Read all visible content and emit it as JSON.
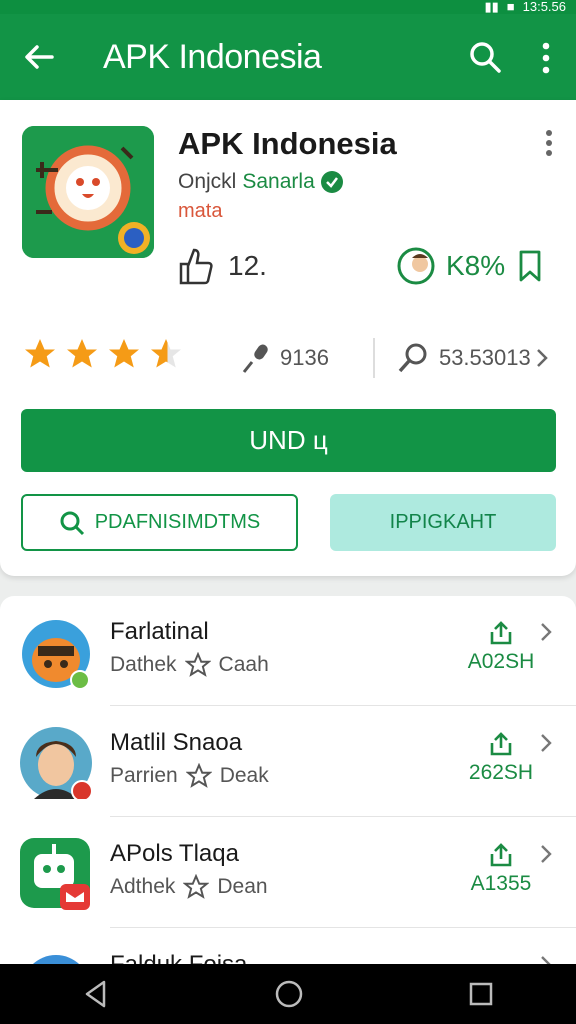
{
  "status_bar": {
    "time": "13:5.56"
  },
  "app_bar": {
    "title": "APK Indonesia"
  },
  "app": {
    "name": "APK Indonesia",
    "developer_prefix": "Onjckl",
    "developer_name": "Sanarla",
    "tag": "mata",
    "left_metric": "12.",
    "right_metric": "K8%",
    "rating_stars": 3.6,
    "downloads": "9136",
    "reviews": "53.53013"
  },
  "buttons": {
    "install": "UND ц",
    "secondary": "PDAFNISIMDTMS",
    "tertiary": "IPPIGKAHT"
  },
  "list": [
    {
      "name": "Farlatinal",
      "meta1": "Dathek",
      "meta2": "Caah",
      "size": "A02SH"
    },
    {
      "name": "Matlil Snaoa",
      "meta1": "Parrien",
      "meta2": "Deak",
      "size": "262SH"
    },
    {
      "name": "APols Tlaqa",
      "meta1": "Adthek",
      "meta2": "Dean",
      "size": "A1355"
    },
    {
      "name": "Falduk Foisa",
      "meta1": "",
      "meta2": "",
      "size": ""
    }
  ],
  "colors": {
    "primary": "#129446",
    "accent_teal": "#aeeadf",
    "star": "#f59b16",
    "tag": "#d9573b"
  }
}
